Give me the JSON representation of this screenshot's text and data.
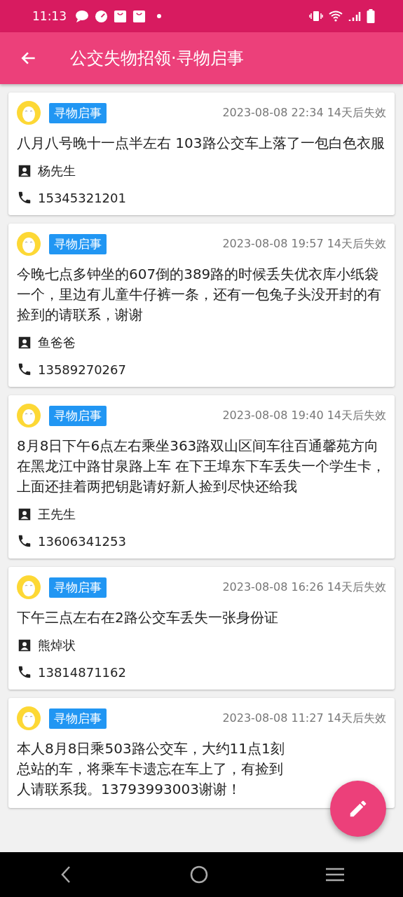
{
  "status_bar": {
    "time": "11:13"
  },
  "app_bar": {
    "title": "公交失物招领·寻物启事"
  },
  "posts": [
    {
      "tag": "寻物启事",
      "time": "2023-08-08 22:34 14天后失效",
      "description": "八月八号晚十一点半左右 103路公交车上落了一包白色衣服",
      "contact": "杨先生",
      "phone": "15345321201"
    },
    {
      "tag": "寻物启事",
      "time": "2023-08-08 19:57 14天后失效",
      "description": "今晚七点多钟坐的607倒的389路的时候丢失优衣库小纸袋一个，里边有儿童牛仔裤一条，还有一包兔子头没开封的有捡到的请联系，谢谢",
      "contact": "鱼爸爸",
      "phone": "13589270267"
    },
    {
      "tag": "寻物启事",
      "time": "2023-08-08 19:40 14天后失效",
      "description": "8月8日下午6点左右乘坐363路双山区间车往百通馨苑方向在黑龙江中路甘泉路上车 在下王埠东下车丢失一个学生卡，上面还挂着两把钥匙请好新人捡到尽快还给我",
      "contact": "王先生",
      "phone": "13606341253"
    },
    {
      "tag": "寻物启事",
      "time": "2023-08-08 16:26 14天后失效",
      "description": "下午三点左右在2路公交车丢失一张身份证",
      "contact": "熊焯状",
      "phone": "13814871162"
    },
    {
      "tag": "寻物启事",
      "time": "2023-08-08 11:27 14天后失效",
      "description_lines": [
        "本人8月8日乘503路公交车，大约11点1刻",
        "总站的车，将乘车卡遗忘在车上了，有捡到",
        "人请联系我。13793993003谢谢！"
      ]
    }
  ]
}
